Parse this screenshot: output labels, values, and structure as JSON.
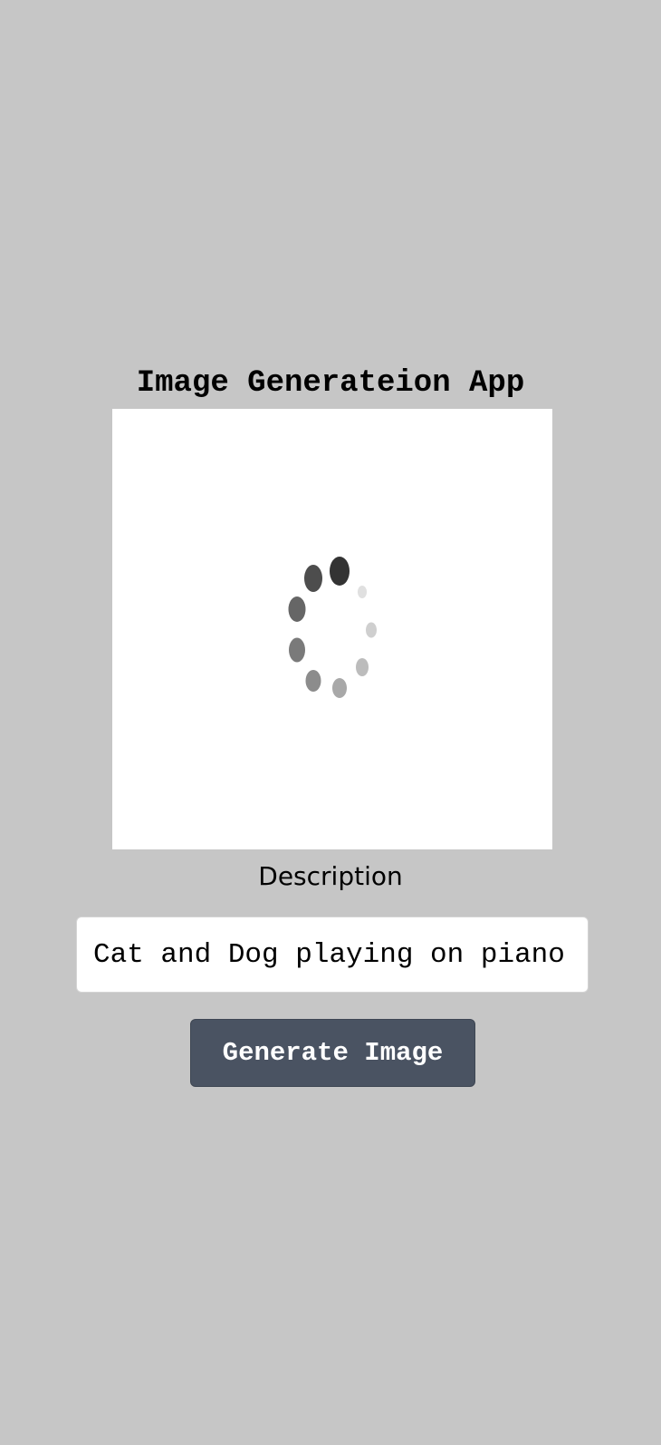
{
  "app": {
    "title": "Image Generateion App"
  },
  "preview": {
    "loading_icon": "spinner-icon"
  },
  "form": {
    "description_label": "Description",
    "description_value": "Cat and Dog playing on piano",
    "generate_button_label": "Generate Image"
  },
  "colors": {
    "background": "#c6c6c6",
    "button": "#4a5362",
    "preview_bg": "#ffffff"
  }
}
